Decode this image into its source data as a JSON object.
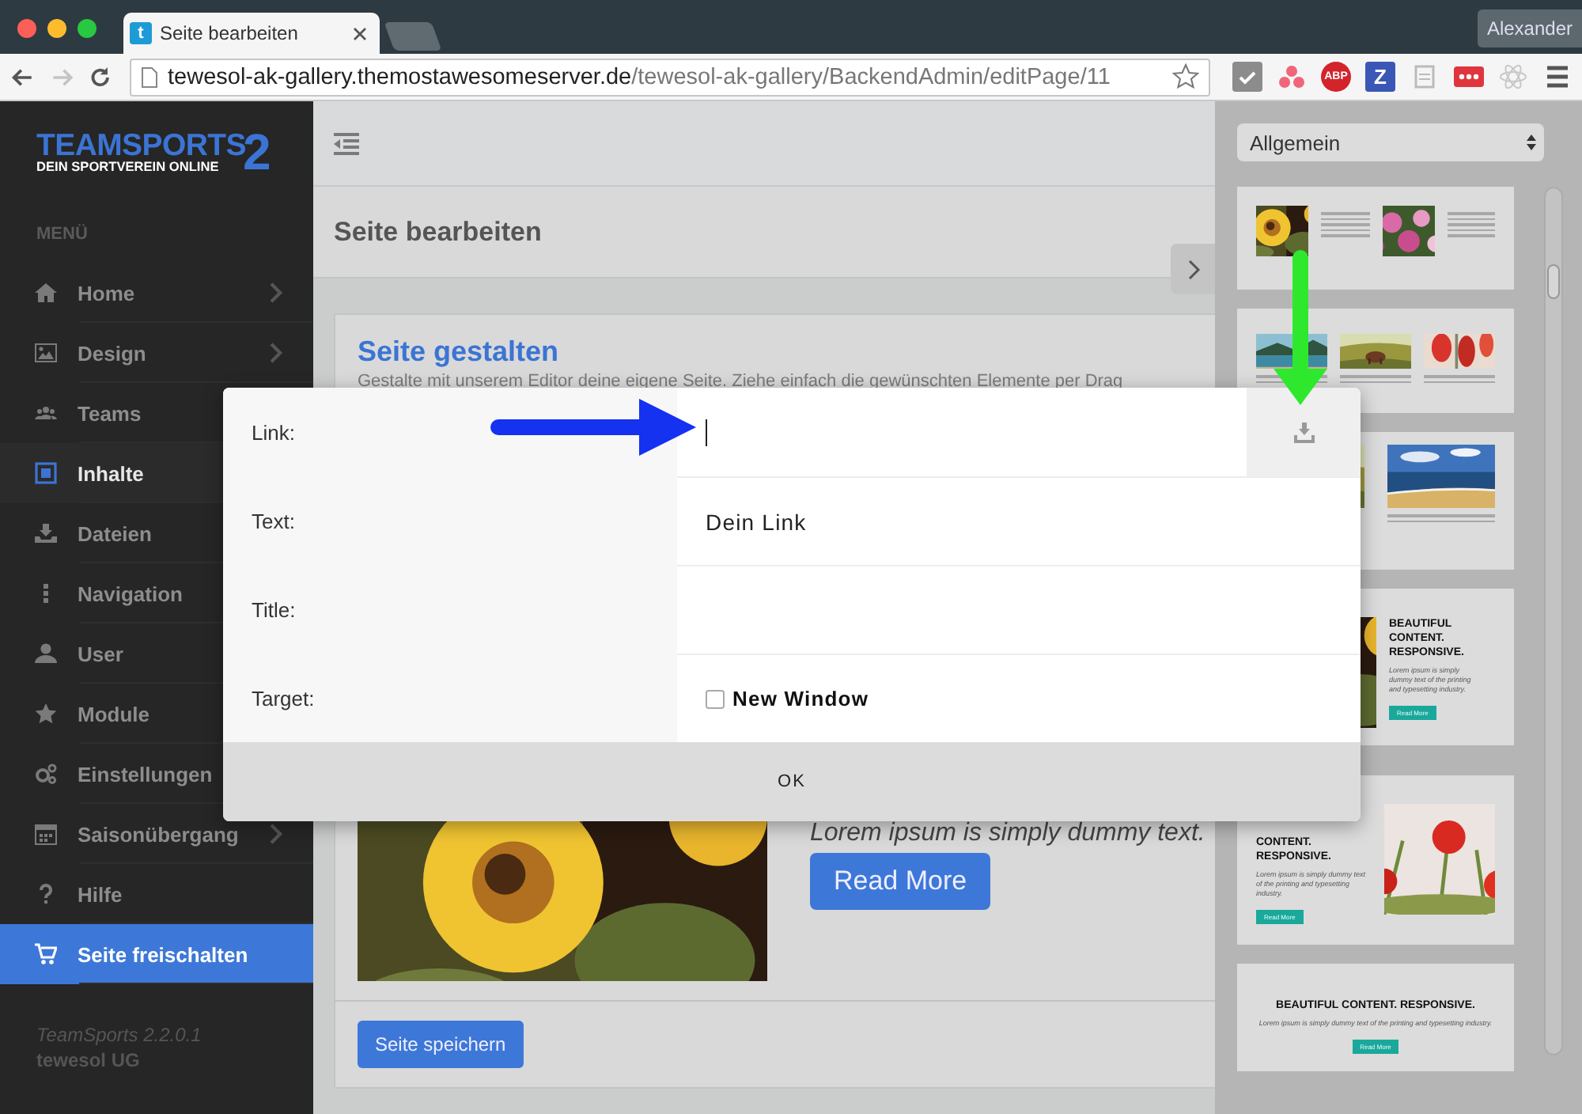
{
  "browser": {
    "tab": {
      "title": "Seite bearbeiten",
      "favicon": "t"
    },
    "profile": "Alexander",
    "nav": {
      "back_disabled": false,
      "forward_disabled": true
    },
    "url": {
      "host": "tewesol-ak-gallery.themostawesomeserver.de",
      "path": "/tewesol-ak-gallery/BackendAdmin/editPage/11"
    },
    "extensions": [
      {
        "kind": "check"
      },
      {
        "kind": "dots"
      },
      {
        "kind": "badge",
        "label": "ABP",
        "color": "#d3242c"
      },
      {
        "kind": "badge",
        "label": "Z",
        "color": "#3b57b5"
      },
      {
        "kind": "doc"
      },
      {
        "kind": "dotbox"
      },
      {
        "kind": "atom"
      }
    ]
  },
  "sidebar": {
    "logo": {
      "title": "TEAMSPORTS",
      "subtitle": "DEIN SPORTVEREIN ONLINE",
      "number": "2"
    },
    "menu_heading": "MENÜ",
    "items": [
      {
        "label": "Home",
        "selected": false,
        "highlighted": false,
        "has_submenu": true
      },
      {
        "label": "Design",
        "selected": false,
        "highlighted": false,
        "has_submenu": true
      },
      {
        "label": "Teams",
        "selected": false,
        "highlighted": false,
        "has_submenu": false
      },
      {
        "label": "Inhalte",
        "selected": true,
        "highlighted": false,
        "has_submenu": false
      },
      {
        "label": "Dateien",
        "selected": false,
        "highlighted": false,
        "has_submenu": false
      },
      {
        "label": "Navigation",
        "selected": false,
        "highlighted": false,
        "has_submenu": false
      },
      {
        "label": "User",
        "selected": false,
        "highlighted": false,
        "has_submenu": false
      },
      {
        "label": "Module",
        "selected": false,
        "highlighted": false,
        "has_submenu": false
      },
      {
        "label": "Einstellungen",
        "selected": false,
        "highlighted": false,
        "has_submenu": false
      },
      {
        "label": "Saisonübergang",
        "selected": false,
        "highlighted": false,
        "has_submenu": true
      },
      {
        "label": "Hilfe",
        "selected": false,
        "highlighted": false,
        "has_submenu": false
      },
      {
        "label": "Seite freischalten",
        "selected": false,
        "highlighted": true,
        "has_submenu": false
      }
    ],
    "footer": {
      "version": "TeamSports 2.2.0.1",
      "company": "tewesol UG"
    }
  },
  "main": {
    "page_title": "Seite bearbeiten",
    "card": {
      "heading": "Seite gestalten",
      "description": "Gestalte mit unserem Editor deine eigene Seite. Ziehe einfach die gewünschten Elemente per Drag",
      "teaser_text": "Lorem ipsum is simply dummy text.",
      "teaser_button": "Read More",
      "save_button": "Seite speichern"
    }
  },
  "panel": {
    "category": "Allgemein",
    "templates": [
      {
        "kind": "two-images"
      },
      {
        "kind": "three-images"
      },
      {
        "kind": "image-pair"
      },
      {
        "kind": "image-text",
        "heading": "BEAUTIFUL CONTENT. RESPONSIVE.",
        "body": "Lorem ipsum is simply dummy text of the printing and typesetting industry.",
        "button": "Read More"
      },
      {
        "kind": "text-image",
        "heading": "CONTENT. RESPONSIVE.",
        "body": "Lorem ipsum is simply dummy text of the printing and typesetting industry.",
        "button": "Read More"
      },
      {
        "kind": "centered",
        "heading": "BEAUTIFUL CONTENT. RESPONSIVE.",
        "body": "Lorem ipsum is simply dummy text of the printing and typesetting industry.",
        "button": "Read More"
      }
    ]
  },
  "dialog": {
    "fields": [
      {
        "label": "Link:",
        "kind": "input-browse",
        "focused": true
      },
      {
        "label": "Text:",
        "kind": "input",
        "value": "Dein Link",
        "focused": false
      },
      {
        "label": "Title:",
        "kind": "input",
        "focused": false
      },
      {
        "label": "Target:",
        "kind": "checkbox",
        "option": "New Window",
        "checked": false
      }
    ],
    "ok_button": "OK"
  },
  "annotations": [
    {
      "kind": "horizontal",
      "color": "#1432f0"
    },
    {
      "kind": "vertical",
      "color": "#2ee82e"
    }
  ]
}
